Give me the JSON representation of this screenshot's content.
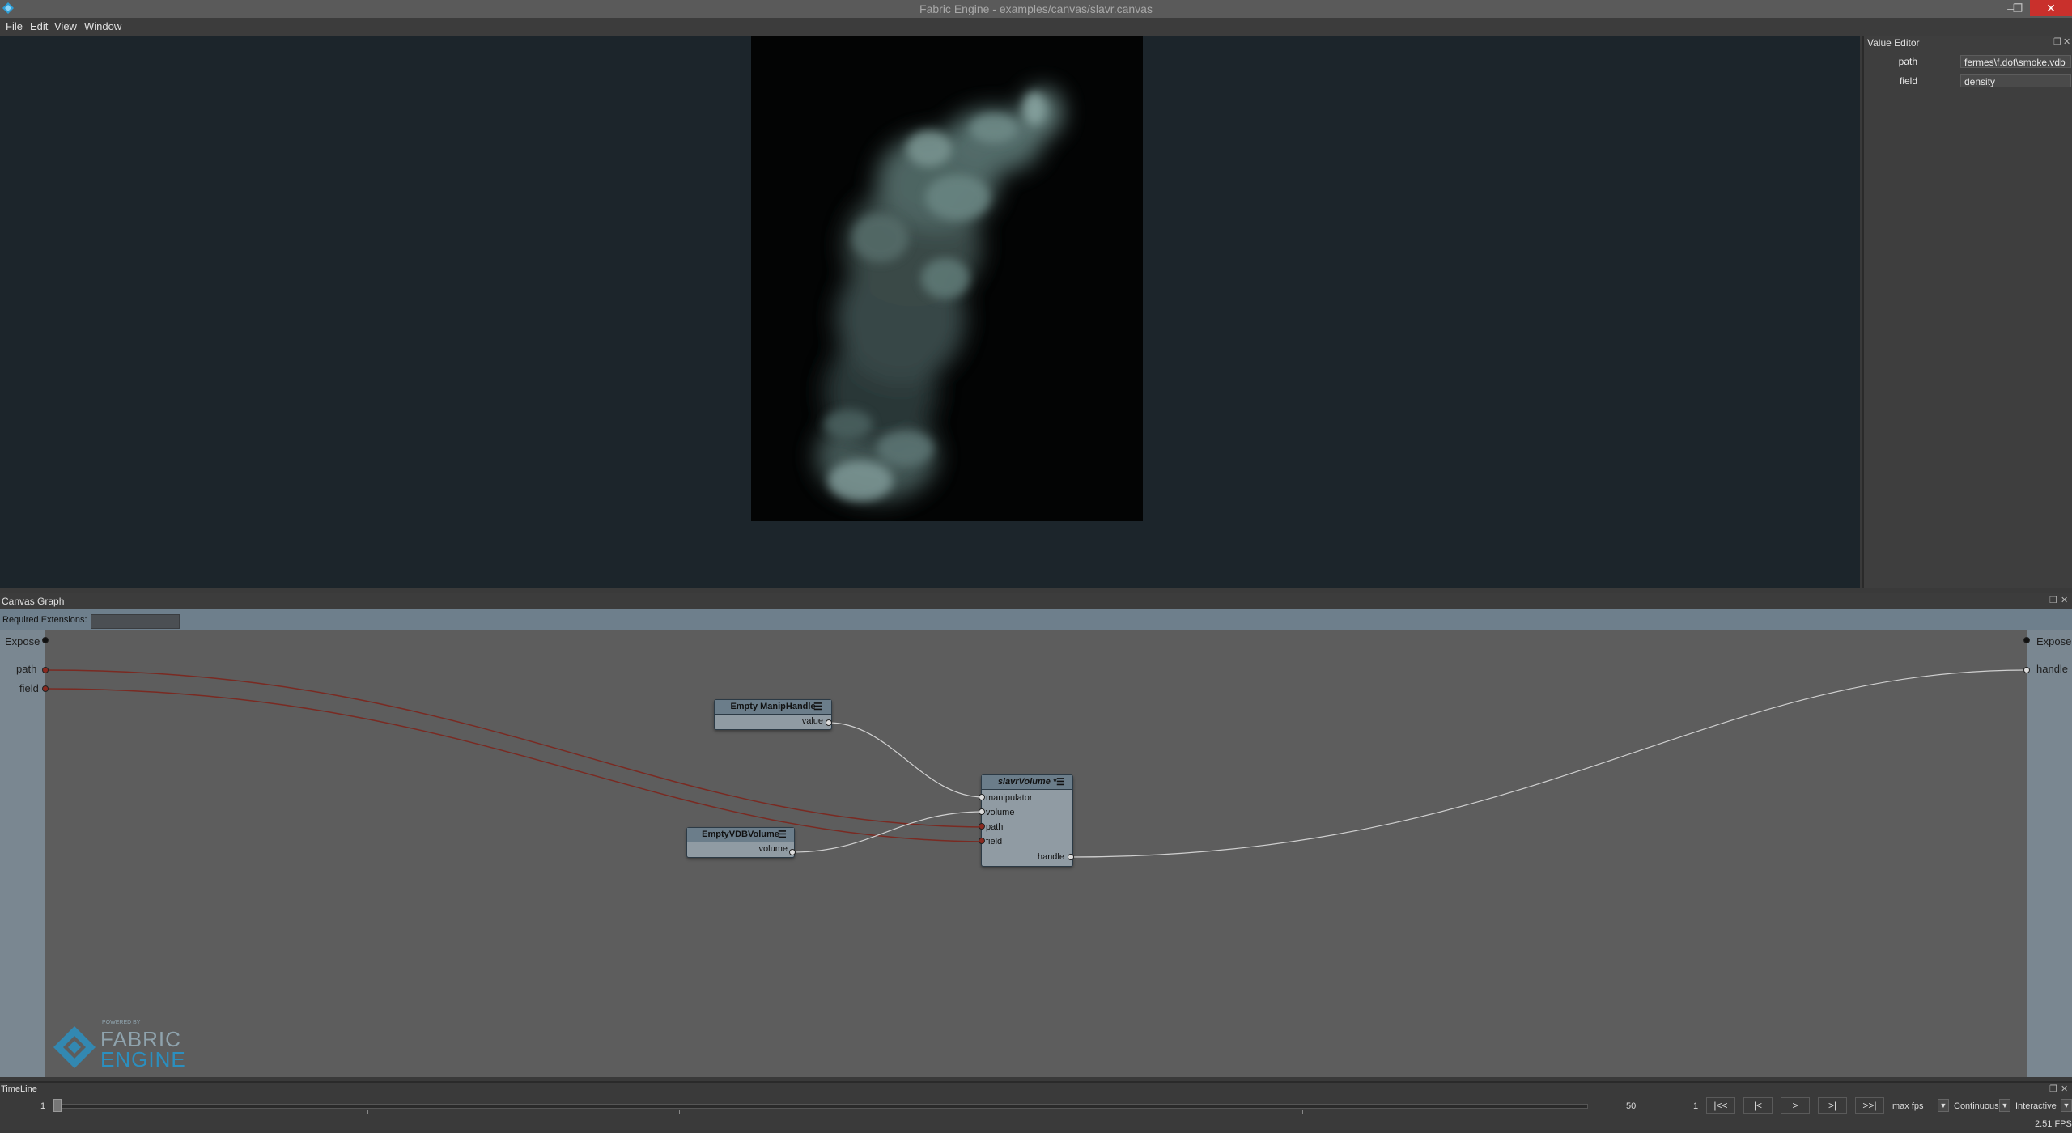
{
  "window": {
    "title": "Fabric Engine - examples/canvas/slavr.canvas",
    "minimize": "–",
    "maximize": "❐",
    "close": "✕"
  },
  "menu": [
    "File",
    "Edit",
    "View",
    "Window"
  ],
  "value_editor": {
    "title": "Value Editor",
    "fields": [
      {
        "label": "path",
        "value": "fermes\\f.dot\\smoke.vdb"
      },
      {
        "label": "field",
        "value": "density"
      }
    ]
  },
  "canvas_graph": {
    "title": "Canvas Graph",
    "required_extensions_label": "Required Extensions:",
    "required_extensions_value": "",
    "left_ports": [
      "Expose",
      "path",
      "field"
    ],
    "right_ports": [
      "Expose",
      "handle"
    ],
    "nodes": {
      "manip": {
        "title": "Empty ManipHandle",
        "out": "value"
      },
      "vdb": {
        "title": "EmptyVDBVolume",
        "out": "volume"
      },
      "slavr": {
        "title": "slavrVolume *",
        "inputs": [
          "manipulator",
          "volume",
          "path",
          "field"
        ],
        "out": "handle"
      }
    },
    "logo": {
      "powered_by": "POWERED BY",
      "line1": "FABRIC",
      "line2": "ENGINE"
    }
  },
  "timeline": {
    "title": "TimeLine",
    "start": "1",
    "end": "50",
    "current": "1",
    "buttons": [
      "|<<",
      "|<",
      ">",
      ">|",
      ">>|"
    ],
    "fps_mode": "max fps",
    "playback": "Continuous",
    "mode": "Interactive",
    "fps_readout": "2.51 FPS"
  },
  "colors": {
    "viewport_bg": "#1c252b",
    "graph_bg": "#5d5d5d",
    "rail": "#7a8791",
    "accent": "#2e9fd8",
    "wire_red": "#7a2a22"
  }
}
